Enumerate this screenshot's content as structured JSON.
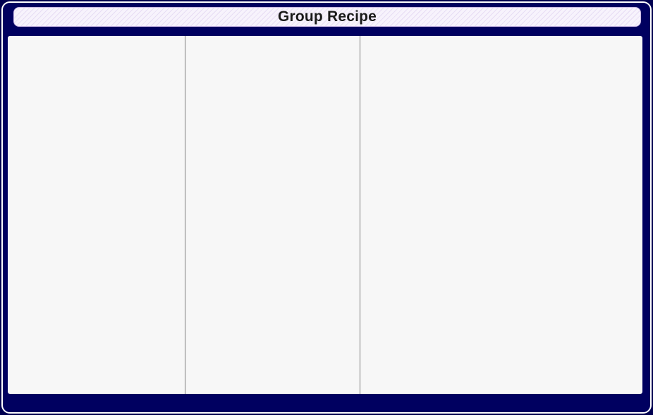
{
  "window": {
    "title": "Group Recipe"
  },
  "colors": {
    "frame": "#000060",
    "border": "#ffffff",
    "panel_background": "#f7f7f7",
    "divider": "#7a7a7a"
  },
  "panes": [
    {
      "name": "left-pane"
    },
    {
      "name": "middle-pane"
    },
    {
      "name": "right-pane"
    }
  ]
}
